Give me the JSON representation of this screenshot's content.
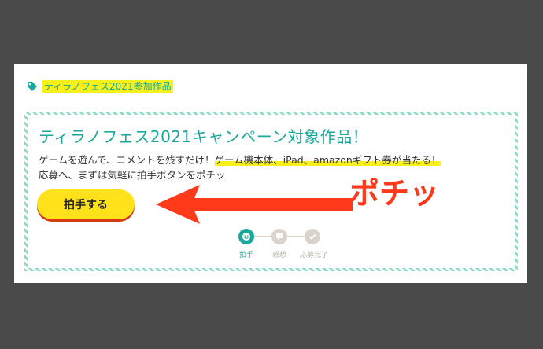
{
  "tag": {
    "label": "ティラノフェス2021参加作品",
    "icon": "tag-icon"
  },
  "campaign": {
    "title": "ティラノフェス2021キャンペーン対象作品！",
    "desc_line1_prefix": "ゲームを遊んで、コメントを残すだけ！",
    "desc_line1_highlight": "ゲーム機本体、iPad、amazonギフト券が当たる！",
    "desc_line2": "応募へ、まずは気軽に拍手ボタンをポチッ",
    "button_label": "拍手する",
    "annotation": "ポチッ"
  },
  "steps": [
    {
      "label": "拍手",
      "icon": "smile-icon",
      "active": true
    },
    {
      "label": "感想",
      "icon": "comment-icon",
      "active": false
    },
    {
      "label": "応募完了",
      "icon": "check-icon",
      "active": false
    }
  ],
  "colors": {
    "accent": "#1aa89a",
    "highlight": "#f7f01a",
    "arrow": "#ff3a1a",
    "button": "#ffe21a"
  }
}
